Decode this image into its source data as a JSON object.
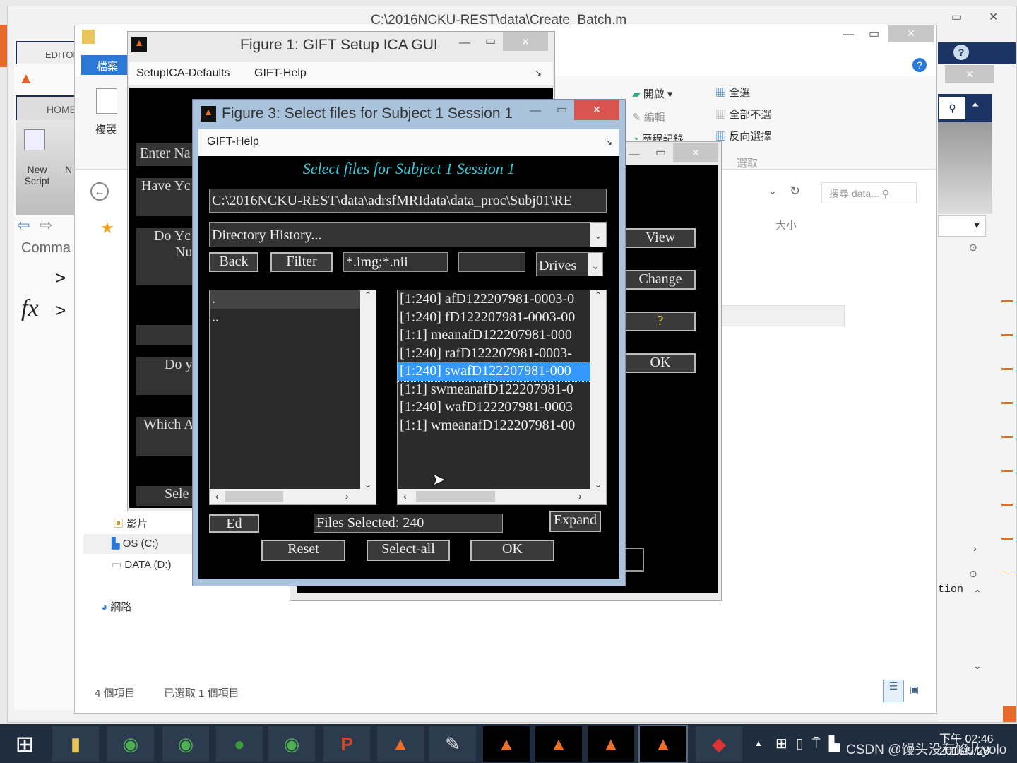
{
  "editor_window": {
    "title": "C:\\2016NCKU-REST\\data\\Create_Batch.m"
  },
  "matlab": {
    "tab_editor": "EDITOR",
    "tab_home": "HOME",
    "new_script": "New Script",
    "new_short": "N",
    "command_window": "Comma",
    "prompt": ">",
    "fx": "fx"
  },
  "explorer": {
    "file_tab": "檔案",
    "copy": "複製",
    "open": "開啟",
    "edit": "編輯",
    "history": "歷程記錄",
    "select_all": "全選",
    "select_none": "全部不選",
    "invert_select": "反向選擇",
    "select_group": "選取",
    "search_placeholder": "搜尋 data...",
    "col_size": "大小",
    "nav": [
      {
        "label": "影片"
      },
      {
        "label": "OS (C:)"
      },
      {
        "label": "DATA (D:)"
      },
      {
        "label": "網路"
      }
    ],
    "status_items": "4 個項目",
    "status_selected": "已選取 1 個項目"
  },
  "figure1": {
    "title": "Figure 1: GIFT Setup ICA GUI",
    "menu": [
      "SetupICA-Defaults",
      "GIFT-Help"
    ],
    "labels": [
      "Enter Na",
      "Have Yc",
      "Do Yc",
      "Nu",
      "Do y",
      "Which A",
      "Sele"
    ]
  },
  "figure2": {
    "buttons": [
      "View",
      "Change",
      "?",
      "OK"
    ]
  },
  "figure3": {
    "title": "Figure 3: Select files for Subject 1 Session 1",
    "menu": "GIFT-Help",
    "heading": "Select files for Subject 1 Session 1",
    "path": "C:\\2016NCKU-REST\\data\\adrsfMRIdata\\data_proc\\Subj01\\RE",
    "dir_history": "Directory History...",
    "back": "Back",
    "filter": "Filter",
    "filter_value": "*.img;*.nii",
    "drives": "Drives",
    "dirs": [
      ".",
      ".."
    ],
    "files": [
      "[1:240] afD122207981-0003-0",
      "[1:240] fD122207981-0003-00",
      "[1:1] meanafD122207981-000",
      "[1:240] rafD122207981-0003-",
      "[1:240] swafD122207981-000",
      "[1:1] swmeanafD122207981-0",
      "[1:240] wafD122207981-0003",
      "[1:1] wmeanafD122207981-00"
    ],
    "selected_index": 4,
    "ed": "Ed",
    "files_selected": "Files Selected: 240",
    "expand": "Expand",
    "reset": "Reset",
    "select_all": "Select-all",
    "ok": "OK"
  },
  "matlab_right": {
    "option_text": "tion"
  },
  "taskbar": {
    "time": "下午 02:46",
    "date": "2016/5/28",
    "watermark": "CSDN @馒头没有馅儿yolo"
  },
  "colors": {
    "selection": "#3399ff",
    "heading": "#3cc8d8",
    "close": "#d9534f"
  }
}
